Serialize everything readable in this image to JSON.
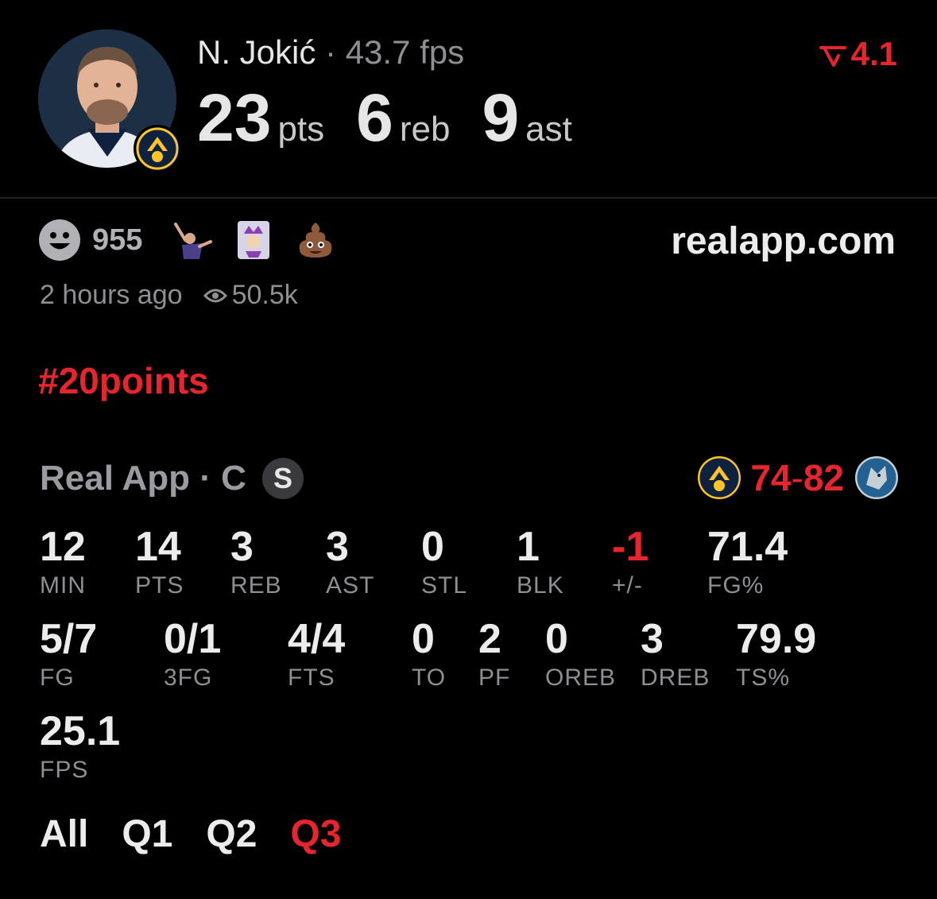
{
  "player": {
    "name": "N. Jokić",
    "separator": "·",
    "fps": "43.7 fps",
    "rating": "4.1",
    "headline": [
      {
        "value": "23",
        "unit": "pts"
      },
      {
        "value": "6",
        "unit": "reb"
      },
      {
        "value": "9",
        "unit": "ast"
      }
    ]
  },
  "post": {
    "reaction_count": "955",
    "site": "realapp.com",
    "time": "2 hours ago",
    "views": "50.5k",
    "hashtag": "#20points"
  },
  "game": {
    "source": "Real App · C",
    "badge": "S",
    "score_home": "74",
    "score_dash": "-",
    "score_away": "82"
  },
  "stats_row1": [
    {
      "value": "12",
      "label": "MIN"
    },
    {
      "value": "14",
      "label": "PTS"
    },
    {
      "value": "3",
      "label": "REB"
    },
    {
      "value": "3",
      "label": "AST"
    },
    {
      "value": "0",
      "label": "STL"
    },
    {
      "value": "1",
      "label": "BLK"
    },
    {
      "value": "-1",
      "label": "+/-"
    },
    {
      "value": "71.4",
      "label": "FG%"
    }
  ],
  "stats_row2": [
    {
      "value": "5/7",
      "label": "FG"
    },
    {
      "value": "0/1",
      "label": "3FG"
    },
    {
      "value": "4/4",
      "label": "FTS"
    },
    {
      "value": "0",
      "label": "TO"
    },
    {
      "value": "2",
      "label": "PF"
    },
    {
      "value": "0",
      "label": "OREB"
    },
    {
      "value": "3",
      "label": "DREB"
    },
    {
      "value": "79.9",
      "label": "TS%"
    }
  ],
  "stats_row3": [
    {
      "value": "25.1",
      "label": "FPS"
    }
  ],
  "tabs": [
    "All",
    "Q1",
    "Q2",
    "Q3"
  ],
  "active_tab": "Q3",
  "colors": {
    "accent": "#e8252f",
    "muted": "#8e8e93",
    "text": "#ececec",
    "background": "#000000"
  },
  "icons": [
    "smiley-icon",
    "eye-icon",
    "rating-arrow-icon",
    "nuggets-logo-icon",
    "timberwolves-logo-icon",
    "poop-emoji-icon",
    "jester-card-icon",
    "player-celebrate-icon"
  ]
}
